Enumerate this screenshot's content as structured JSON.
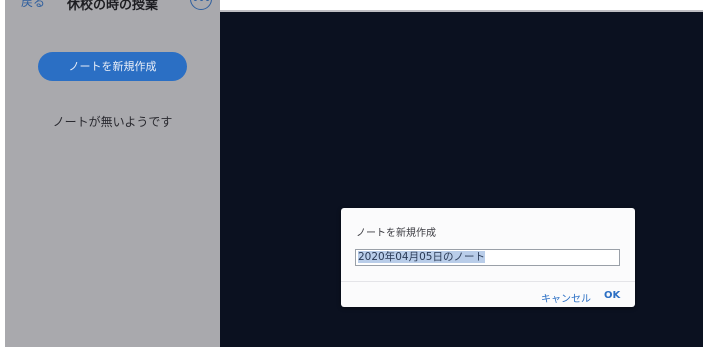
{
  "sidebar": {
    "back_label": "戻る",
    "title": "休校の時の授業",
    "more_label": "•••",
    "new_note_label": "ノートを新規作成",
    "empty_message": "ノートが無いようです"
  },
  "dialog": {
    "title": "ノートを新規作成",
    "input_value": "2020年04月05日のノート",
    "cancel_label": "キャンセル",
    "ok_label": "OK"
  },
  "colors": {
    "sidebar_bg": "#a9a9ad",
    "main_bg": "#0b1120",
    "accent": "#2b6fc4",
    "selection": "#b9cde9"
  }
}
